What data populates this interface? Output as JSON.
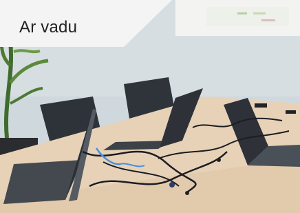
{
  "label": {
    "text": "Ar vadu"
  },
  "photo": {
    "subject": "laptops-with-cables-on-meeting-table",
    "colors": {
      "wall": "#cfd7dc",
      "table": "#e6cfb4",
      "chair": "#2e3239",
      "laptop": "#3a3f46",
      "cable": "#1b1d22",
      "plant": "#3f6b2e",
      "accent_cable": "#4a90d9",
      "label_bg": "#f4f4f4"
    }
  }
}
